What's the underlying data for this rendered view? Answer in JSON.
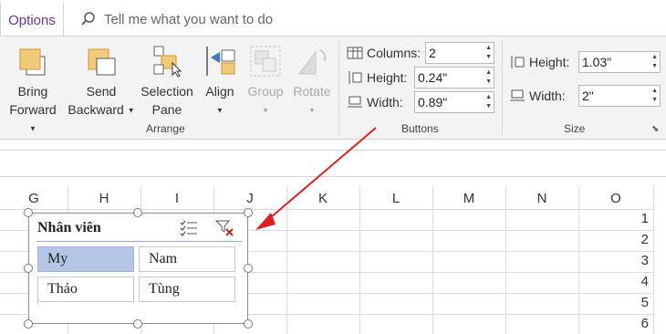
{
  "tabs": {
    "options": "Options"
  },
  "search": {
    "placeholder": "Tell me what you want to do"
  },
  "arrange": {
    "bring_forward": [
      "Bring",
      "Forward"
    ],
    "send_backward": [
      "Send",
      "Backward"
    ],
    "selection_pane": [
      "Selection",
      "Pane"
    ],
    "align": "Align",
    "group": "Group",
    "rotate": "Rotate",
    "group_label": "Arrange"
  },
  "buttons": {
    "columns_label": "Columns:",
    "columns_value": "2",
    "height_label": "Height:",
    "height_value": "0.24\"",
    "width_label": "Width:",
    "width_value": "0.89\"",
    "group_label": "Buttons"
  },
  "size": {
    "height_label": "Height:",
    "height_value": "1.03\"",
    "width_label": "Width:",
    "width_value": "2\"",
    "group_label": "Size"
  },
  "columns": [
    "G",
    "H",
    "I",
    "J",
    "K",
    "L",
    "M",
    "N",
    "O"
  ],
  "rows": [
    "1",
    "2",
    "3",
    "4",
    "5",
    "6"
  ],
  "slicer": {
    "title": "Nhân viên",
    "items": [
      {
        "label": "My",
        "selected": true
      },
      {
        "label": "Nam",
        "selected": false
      },
      {
        "label": "Thảo",
        "selected": false
      },
      {
        "label": "Tùng",
        "selected": false
      }
    ]
  },
  "colors": {
    "accent_tab": "#7030a0",
    "selected_item": "#b4c7e7",
    "annotation_arrow": "#e02020"
  }
}
